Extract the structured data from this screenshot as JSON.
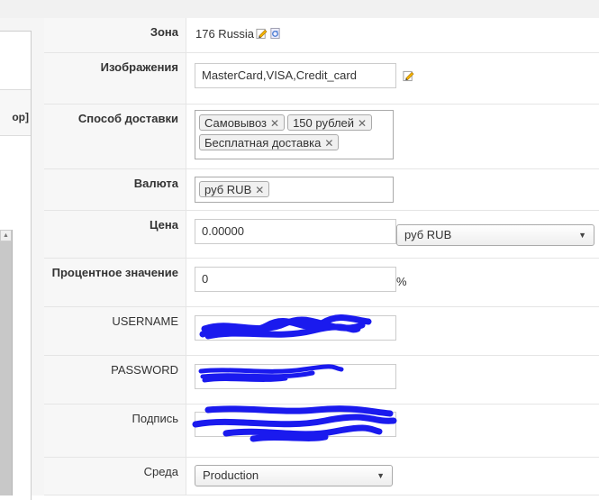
{
  "sidebar": {
    "column_fragment": "ор]",
    "scroll_up": "▲"
  },
  "form": {
    "zone": {
      "label": "Зона",
      "value": "176 Russia"
    },
    "images": {
      "label": "Изображения",
      "value": "MasterCard,VISA,Credit_card"
    },
    "delivery": {
      "label": "Способ доставки",
      "chips": [
        "Самовывоз",
        "150 рублей",
        "Бесплатная доставка"
      ]
    },
    "currency": {
      "label": "Валюта",
      "chips": [
        "руб RUB"
      ]
    },
    "price": {
      "label": "Цена",
      "value": "0.00000",
      "currency_select": "руб RUB"
    },
    "percent": {
      "label": "Процентное значение",
      "value": "0",
      "suffix": "%"
    },
    "username": {
      "label": "USERNAME"
    },
    "password": {
      "label": "PASSWORD"
    },
    "signature": {
      "label": "Подпись"
    },
    "environment": {
      "label": "Среда",
      "value": "Production"
    }
  },
  "colors": {
    "redaction": "#1a1aee",
    "label_bg": "#f7f7f7",
    "border": "#cccccc"
  },
  "icons": {
    "edit": "pencil-edit-icon",
    "refresh": "refresh-icon",
    "remove": "remove-x-icon",
    "dropdown": "chevron-down-icon"
  }
}
